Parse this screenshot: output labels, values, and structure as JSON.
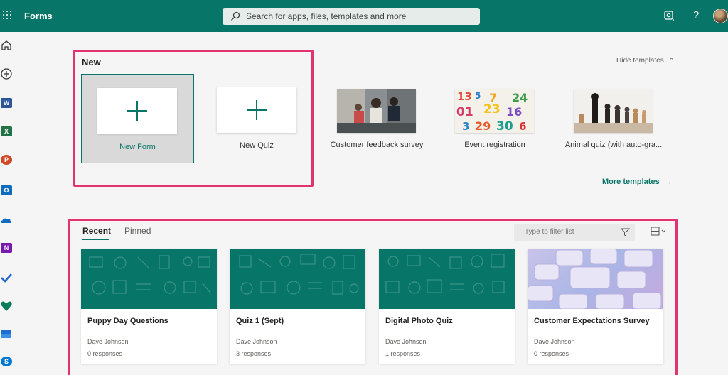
{
  "topbar": {
    "app_name": "Forms",
    "search_placeholder": "Search for apps, files, templates and more",
    "help_label": "?"
  },
  "rail": {
    "apps": [
      {
        "name": "word",
        "letter": "W",
        "color": "#2b579a"
      },
      {
        "name": "excel",
        "letter": "X",
        "color": "#217346"
      },
      {
        "name": "powerpoint",
        "letter": "P",
        "color": "#d24726"
      },
      {
        "name": "outlook",
        "letter": "O",
        "color": "#0f6cbd"
      },
      {
        "name": "onenote",
        "letter": "N",
        "color": "#7719aa"
      },
      {
        "name": "sway",
        "letter": "S",
        "color": "#0078d4"
      }
    ]
  },
  "new_section": {
    "heading": "New",
    "hide_templates": "Hide templates",
    "new_form": "New Form",
    "new_quiz": "New Quiz",
    "templates": [
      {
        "label": "Customer feedback survey",
        "icon": "office-meeting-photo"
      },
      {
        "label": "Event registration",
        "icon": "colorful-numbers-photo"
      },
      {
        "label": "Animal quiz (with auto-gra...",
        "icon": "chess-pieces-photo"
      }
    ],
    "more_templates": "More templates"
  },
  "recent_section": {
    "tabs": [
      "Recent",
      "Pinned"
    ],
    "filter_placeholder": "Type to filter list",
    "forms": [
      {
        "title": "Puppy Day Questions",
        "owner": "Dave Johnson",
        "responses": "0 responses"
      },
      {
        "title": "Quiz 1 (Sept)",
        "owner": "Dave Johnson",
        "responses": "3 responses"
      },
      {
        "title": "Digital Photo Quiz",
        "owner": "Dave Johnson",
        "responses": "1 responses"
      },
      {
        "title": "Customer Expectations Survey",
        "owner": "Dave Johnson",
        "responses": "0 responses"
      }
    ]
  },
  "colors": {
    "brand": "#077568",
    "highlight": "#e0336f"
  }
}
